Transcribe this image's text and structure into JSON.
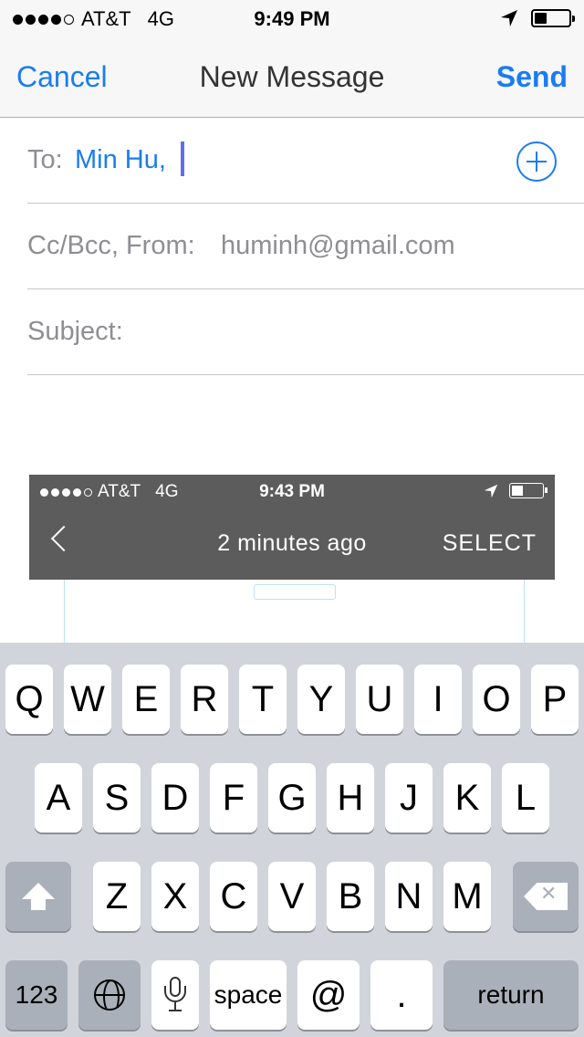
{
  "status_bar": {
    "carrier": "AT&T",
    "network": "4G",
    "time": "9:49 PM",
    "signal_bars_filled": 4,
    "signal_bars_total": 5,
    "battery_level": 0.35
  },
  "nav": {
    "cancel_label": "Cancel",
    "title": "New Message",
    "send_label": "Send",
    "accent_color": "#1a7cf2"
  },
  "compose": {
    "to_label": "To:",
    "to_recipient": "Min Hu,",
    "cc_from_label": "Cc/Bcc, From:",
    "from_value": "huminh@gmail.com",
    "subject_label": "Subject:"
  },
  "embedded_screenshot": {
    "carrier": "AT&T",
    "network": "4G",
    "time": "9:43 PM",
    "title": "2 minutes ago",
    "select_label": "SELECT",
    "battery_level": 0.4
  },
  "keyboard": {
    "row1": [
      "Q",
      "W",
      "E",
      "R",
      "T",
      "Y",
      "U",
      "I",
      "O",
      "P"
    ],
    "row2": [
      "A",
      "S",
      "D",
      "F",
      "G",
      "H",
      "J",
      "K",
      "L"
    ],
    "row3": [
      "Z",
      "X",
      "C",
      "V",
      "B",
      "N",
      "M"
    ],
    "numbers_label": "123",
    "space_label": "space",
    "at_label": "@",
    "dot_label": ".",
    "return_label": "return"
  },
  "icons": [
    "location-arrow-icon",
    "battery-icon",
    "add-contact-icon",
    "back-chevron-icon",
    "shift-icon",
    "delete-icon",
    "globe-icon",
    "microphone-icon"
  ]
}
